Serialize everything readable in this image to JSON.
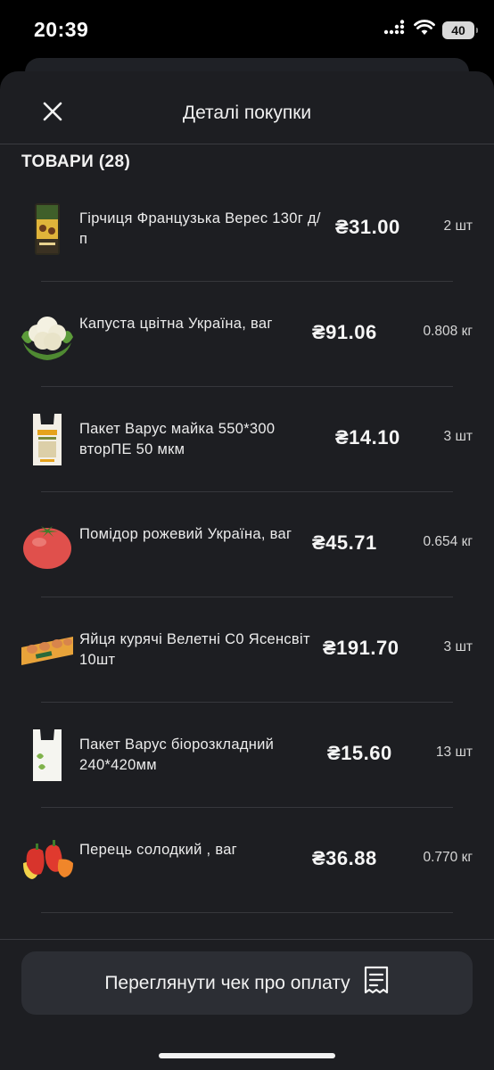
{
  "status_bar": {
    "time": "20:39",
    "battery": "40"
  },
  "header": {
    "title": "Деталі покупки",
    "close_icon": "close-icon"
  },
  "section": {
    "title": "ТОВАРИ (28)"
  },
  "items": [
    {
      "name": "Гірчиця Французька Верес 130г д/п",
      "price": "₴31.00",
      "qty": "2 шт",
      "image": "mustard-jar-icon"
    },
    {
      "name": "Капуста цвітна Україна, ваг",
      "price": "₴91.06",
      "qty": "0.808 кг",
      "image": "cauliflower-icon"
    },
    {
      "name": "Пакет Варус майка 550*300 вторПЕ 50 мкм",
      "price": "₴14.10",
      "qty": "3 шт",
      "image": "plastic-bag-icon"
    },
    {
      "name": "Помідор рожевий Україна, ваг",
      "price": "₴45.71",
      "qty": "0.654 кг",
      "image": "tomato-icon"
    },
    {
      "name": "Яйця курячі Велетні С0 Ясенсвіт 10шт",
      "price": "₴191.70",
      "qty": "3 шт",
      "image": "egg-carton-icon"
    },
    {
      "name": "Пакет Варус біорозкладний 240*420мм",
      "price": "₴15.60",
      "qty": "13 шт",
      "image": "bio-bag-icon"
    },
    {
      "name": "Перець солодкий , ваг",
      "price": "₴36.88",
      "qty": "0.770 кг",
      "image": "bell-pepper-icon"
    }
  ],
  "footer": {
    "receipt_button_label": "Переглянути чек про оплату",
    "receipt_icon": "receipt-icon"
  }
}
